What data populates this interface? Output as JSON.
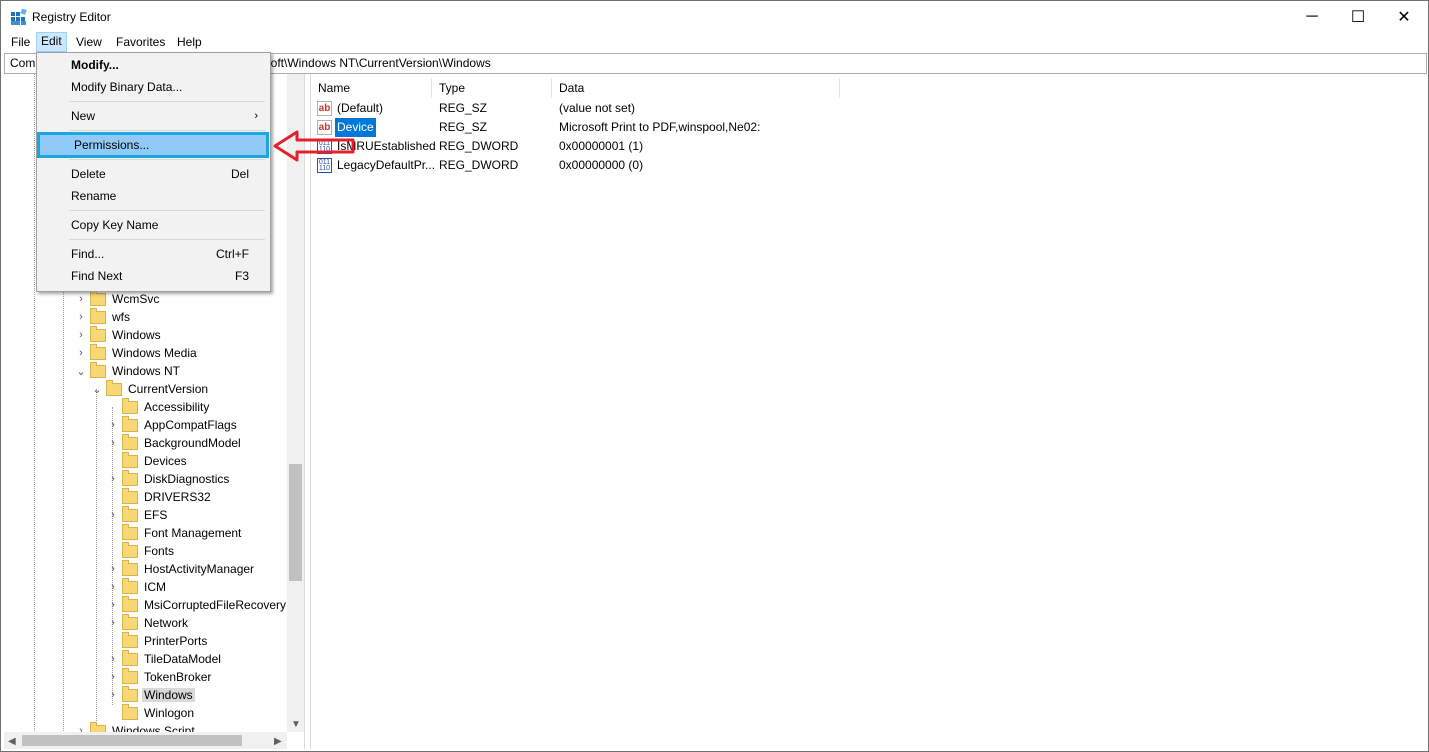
{
  "window": {
    "title": "Registry Editor",
    "controls": {
      "minimize": "─",
      "maximize": "☐",
      "close": "✕"
    }
  },
  "menu": {
    "items": [
      "File",
      "Edit",
      "View",
      "Favorites",
      "Help"
    ],
    "active": "Edit"
  },
  "address": {
    "prefix": "Com",
    "path_tail": "osoft\\Windows NT\\CurrentVersion\\Windows"
  },
  "edit_menu": {
    "modify": "Modify...",
    "modify_binary": "Modify Binary Data...",
    "new": "New",
    "permissions": "Permissions...",
    "delete": "Delete",
    "delete_shortcut": "Del",
    "rename": "Rename",
    "copy_key_name": "Copy Key Name",
    "find": "Find...",
    "find_shortcut": "Ctrl+F",
    "find_next": "Find Next",
    "find_next_shortcut": "F3"
  },
  "tree": {
    "level1": [
      "WcmSvc",
      "wfs",
      "Windows",
      "Windows Media",
      "Windows NT"
    ],
    "current_version": "CurrentVersion",
    "children": [
      "Accessibility",
      "AppCompatFlags",
      "BackgroundModel",
      "Devices",
      "DiskDiagnostics",
      "DRIVERS32",
      "EFS",
      "Font Management",
      "Fonts",
      "HostActivityManager",
      "ICM",
      "MsiCorruptedFileRecovery",
      "Network",
      "PrinterPorts",
      "TileDataModel",
      "TokenBroker",
      "Windows",
      "Winlogon"
    ],
    "partial_bottom": "Windows Script",
    "selected": "Windows"
  },
  "list": {
    "headers": {
      "name": "Name",
      "type": "Type",
      "data": "Data"
    },
    "rows": [
      {
        "name": "(Default)",
        "type": "REG_SZ",
        "data": "(value not set)",
        "icon": "string-value-icon"
      },
      {
        "name": "Device",
        "type": "REG_SZ",
        "data": "Microsoft Print to PDF,winspool,Ne02:",
        "icon": "string-value-icon"
      },
      {
        "name": "IsMRUEstablished",
        "type": "REG_DWORD",
        "data": "0x00000001 (1)",
        "icon": "dword-value-icon"
      },
      {
        "name": "LegacyDefaultPr...",
        "type": "REG_DWORD",
        "data": "0x00000000 (0)",
        "icon": "dword-value-icon"
      }
    ],
    "selected_row": "Device"
  },
  "colors": {
    "menu_highlight": "#91c9f7",
    "menu_highlight_border": "#1aa7e0",
    "selection": "#0078d7",
    "annotation_arrow": "#e5202b"
  }
}
